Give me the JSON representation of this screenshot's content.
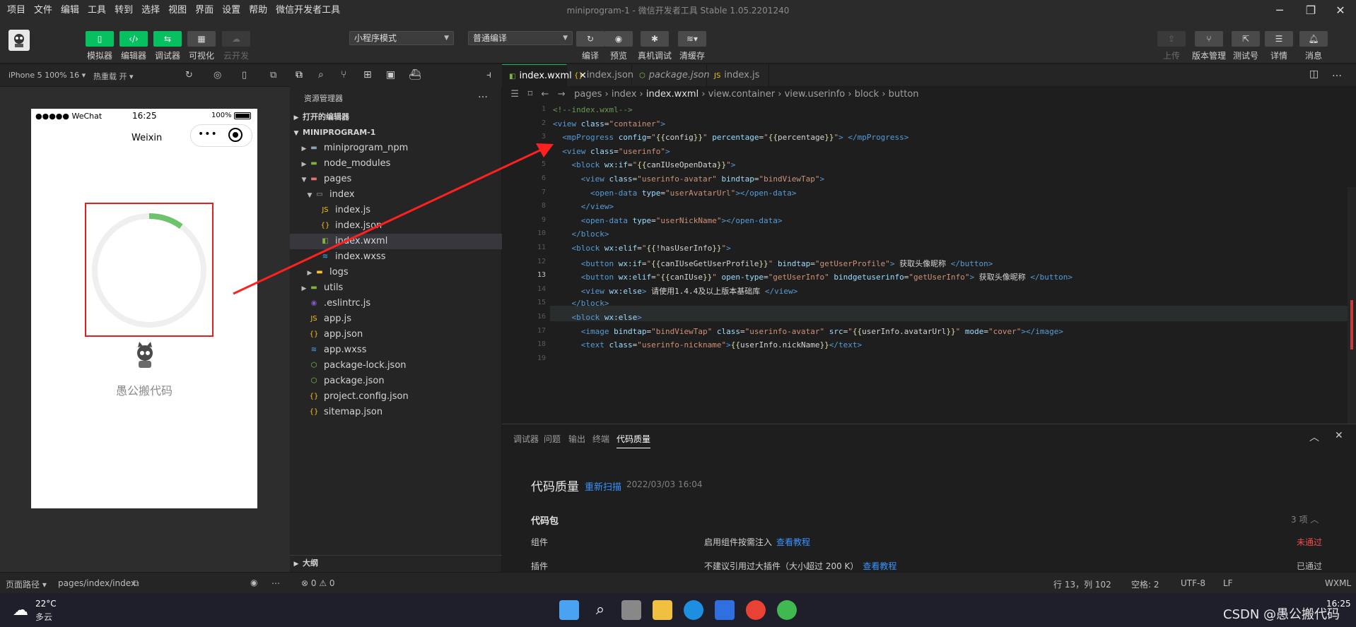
{
  "menubar": {
    "items": [
      "项目",
      "文件",
      "编辑",
      "工具",
      "转到",
      "选择",
      "视图",
      "界面",
      "设置",
      "帮助",
      "微信开发者工具"
    ],
    "title": "miniprogram-1 - 微信开发者工具 Stable 1.05.2201240"
  },
  "toolbar": {
    "left_buttons": [
      {
        "label": "模拟器",
        "icon": "phone-icon"
      },
      {
        "label": "编辑器",
        "icon": "code-icon"
      },
      {
        "label": "调试器",
        "icon": "debug-icon"
      },
      {
        "label": "可视化",
        "icon": "layout-icon"
      },
      {
        "label": "云开发",
        "icon": "cloud-icon"
      }
    ],
    "mode_select": "小程序模式",
    "compile_select": "普通编译",
    "mid_buttons": [
      "编译",
      "预览",
      "真机调试",
      "清缓存"
    ],
    "right_buttons": [
      "上传",
      "版本管理",
      "测试号",
      "详情",
      "消息"
    ]
  },
  "simulator": {
    "device": "iPhone 5 100% 16",
    "hot_reload": "热重载 开",
    "status_left": "●●●●● WeChat",
    "status_time": "16:25",
    "status_battery": "100%",
    "nav_title": "Weixin",
    "progress_percent": 0.1,
    "progress_color": "#6cc36c",
    "track_color": "#efefef",
    "nickname": "愚公搬代码"
  },
  "sim_bottom": {
    "path_label": "页面路径",
    "path": "pages/index/index"
  },
  "explorer": {
    "title": "资源管理器",
    "open_editors": "打开的编辑器",
    "project": "MINIPROGRAM-1",
    "tree": [
      {
        "name": "miniprogram_npm",
        "type": "folder",
        "depth": 1,
        "arrow": "▶"
      },
      {
        "name": "node_modules",
        "type": "folder-green",
        "depth": 1,
        "arrow": "▶"
      },
      {
        "name": "pages",
        "type": "folder-red",
        "depth": 1,
        "arrow": "▼"
      },
      {
        "name": "index",
        "type": "folder-open",
        "depth": 2,
        "arrow": "▼"
      },
      {
        "name": "index.js",
        "type": "js",
        "depth": 3,
        "arrow": ""
      },
      {
        "name": "index.json",
        "type": "json",
        "depth": 3,
        "arrow": ""
      },
      {
        "name": "index.wxml",
        "type": "wxml",
        "depth": 3,
        "arrow": "",
        "selected": true
      },
      {
        "name": "index.wxss",
        "type": "wxss",
        "depth": 3,
        "arrow": ""
      },
      {
        "name": "logs",
        "type": "folder-yellow",
        "depth": 2,
        "arrow": "▶"
      },
      {
        "name": "utils",
        "type": "folder-green",
        "depth": 1,
        "arrow": "▶"
      },
      {
        "name": ".eslintrc.js",
        "type": "eslint",
        "depth": 1,
        "arrow": ""
      },
      {
        "name": "app.js",
        "type": "js",
        "depth": 1,
        "arrow": ""
      },
      {
        "name": "app.json",
        "type": "json",
        "depth": 1,
        "arrow": ""
      },
      {
        "name": "app.wxss",
        "type": "wxss",
        "depth": 1,
        "arrow": ""
      },
      {
        "name": "package-lock.json",
        "type": "npm",
        "depth": 1,
        "arrow": ""
      },
      {
        "name": "package.json",
        "type": "npm",
        "depth": 1,
        "arrow": ""
      },
      {
        "name": "project.config.json",
        "type": "json",
        "depth": 1,
        "arrow": ""
      },
      {
        "name": "sitemap.json",
        "type": "json",
        "depth": 1,
        "arrow": ""
      }
    ],
    "outline": "大纲"
  },
  "tabs": [
    {
      "label": "index.wxml",
      "active": true,
      "icon": "wxml"
    },
    {
      "label": "index.json",
      "active": false,
      "icon": "json"
    },
    {
      "label": "package.json",
      "active": false,
      "icon": "npm"
    },
    {
      "label": "index.js",
      "active": false,
      "icon": "js"
    }
  ],
  "breadcrumbs": [
    "pages",
    "index",
    "index.wxml",
    "view.container",
    "view.userinfo",
    "block",
    "button"
  ],
  "code_lines": [
    {
      "n": "1",
      "html": "<span class='c'>&lt;!--index.wxml--&gt;</span>"
    },
    {
      "n": "2",
      "html": "<span class='t'>&lt;view</span> <span class='a'>class</span>=<span class='s'>\"container\"</span><span class='t'>&gt;</span>"
    },
    {
      "n": "3",
      "html": "  <span class='t'>&lt;mpProgress</span> <span class='a'>config</span>=<span class='s'>\"</span><span class='m'>{{</span><span class='p'>config</span><span class='m'>}}</span><span class='s'>\"</span> <span class='a'>percentage</span>=<span class='s'>\"</span><span class='m'>{{</span><span class='p'>percentage</span><span class='m'>}}</span><span class='s'>\"</span><span class='t'>&gt;</span> <span class='t'>&lt;/mpProgress&gt;</span>"
    },
    {
      "n": "4",
      "html": "  <span class='t'>&lt;view</span> <span class='a'>class</span>=<span class='s'>\"userinfo\"</span><span class='t'>&gt;</span>"
    },
    {
      "n": "5",
      "html": "    <span class='t'>&lt;block</span> <span class='a'>wx:if</span>=<span class='s'>\"</span><span class='m'>{{</span><span class='p'>canIUseOpenData</span><span class='m'>}}</span><span class='s'>\"</span><span class='t'>&gt;</span>"
    },
    {
      "n": "6",
      "html": "      <span class='t'>&lt;view</span> <span class='a'>class</span>=<span class='s'>\"userinfo-avatar\"</span> <span class='a'>bindtap</span>=<span class='s'>\"bindViewTap\"</span><span class='t'>&gt;</span>"
    },
    {
      "n": "7",
      "html": "        <span class='t'>&lt;open-data</span> <span class='a'>type</span>=<span class='s'>\"userAvatarUrl\"</span><span class='t'>&gt;&lt;/open-data&gt;</span>"
    },
    {
      "n": "8",
      "html": "      <span class='t'>&lt;/view&gt;</span>"
    },
    {
      "n": "9",
      "html": "      <span class='t'>&lt;open-data</span> <span class='a'>type</span>=<span class='s'>\"userNickName\"</span><span class='t'>&gt;&lt;/open-data&gt;</span>"
    },
    {
      "n": "10",
      "html": "    <span class='t'>&lt;/block&gt;</span>"
    },
    {
      "n": "11",
      "html": "    <span class='t'>&lt;block</span> <span class='a'>wx:elif</span>=<span class='s'>\"</span><span class='m'>{{</span><span class='p'>!hasUserInfo</span><span class='m'>}}</span><span class='s'>\"</span><span class='t'>&gt;</span>"
    },
    {
      "n": "12",
      "html": "      <span class='t'>&lt;button</span> <span class='a'>wx:if</span>=<span class='s'>\"</span><span class='m'>{{</span><span class='p'>canIUseGetUserProfile</span><span class='m'>}}</span><span class='s'>\"</span> <span class='a'>bindtap</span>=<span class='s'>\"getUserProfile\"</span><span class='t'>&gt;</span> 获取头像昵称 <span class='t'>&lt;/button&gt;</span>"
    },
    {
      "n": "13",
      "html": "      <span class='t'>&lt;button</span> <span class='a'>wx:elif</span>=<span class='s'>\"</span><span class='m'>{{</span><span class='p'>canIUse</span><span class='m'>}}</span><span class='s'>\"</span> <span class='a'>open-type</span>=<span class='s'>\"getUserInfo\"</span> <span class='a'>bindgetuserinfo</span>=<span class='s'>\"getUserInfo\"</span><span class='t'>&gt;</span> 获取头像昵称 <span class='t'>&lt;/button&gt;</span>"
    },
    {
      "n": "14",
      "html": "      <span class='t'>&lt;view</span> <span class='a'>wx:else</span><span class='t'>&gt;</span> 请使用1.4.4及以上版本基础库 <span class='t'>&lt;/view&gt;</span>"
    },
    {
      "n": "15",
      "html": "    <span class='t'>&lt;/block&gt;</span>"
    },
    {
      "n": "16",
      "html": "    <span class='t'>&lt;block</span> <span class='a'>wx:else</span><span class='t'>&gt;</span>"
    },
    {
      "n": "17",
      "html": "      <span class='t'>&lt;image</span> <span class='a'>bindtap</span>=<span class='s'>\"bindViewTap\"</span> <span class='a'>class</span>=<span class='s'>\"userinfo-avatar\"</span> <span class='a'>src</span>=<span class='s'>\"</span><span class='m'>{{</span><span class='p'>userInfo.avatarUrl</span><span class='m'>}}</span><span class='s'>\"</span> <span class='a'>mode</span>=<span class='s'>\"cover\"</span><span class='t'>&gt;&lt;/image&gt;</span>"
    },
    {
      "n": "18",
      "html": "      <span class='t'>&lt;text</span> <span class='a'>class</span>=<span class='s'>\"userinfo-nickname\"</span><span class='t'>&gt;</span><span class='m'>{{</span><span class='p'>userInfo.nickName</span><span class='m'>}}</span><span class='t'>&lt;/text&gt;</span>"
    },
    {
      "n": "19",
      "html": ""
    }
  ],
  "panel": {
    "tabs": [
      "调试器",
      "问题",
      "输出",
      "终端",
      "代码质量"
    ],
    "active_tab": "代码质量",
    "title": "代码质量",
    "rescan": "重新扫描",
    "date": "2022/03/03 16:04",
    "section": "代码包",
    "count": "3 项",
    "rows": [
      {
        "name": "组件",
        "desc": "启用组件按需注入",
        "link": "查看教程",
        "status": "未通过",
        "status_color": "#f14c4c"
      },
      {
        "name": "插件",
        "desc": "不建议引用过大插件（大小超过 200 K）",
        "link": "查看教程",
        "status": "已通过",
        "status_color": "#bdbdbd"
      }
    ]
  },
  "statusbar": {
    "errors": "0",
    "warnings": "0",
    "position": "行 13，列 102",
    "spaces": "空格: 2",
    "encoding": "UTF-8",
    "eol": "LF",
    "lang": "WXML"
  },
  "taskbar": {
    "temp": "22°C",
    "weather": "多云",
    "watermark": "CSDN @愚公搬代码",
    "time": "16:25"
  }
}
